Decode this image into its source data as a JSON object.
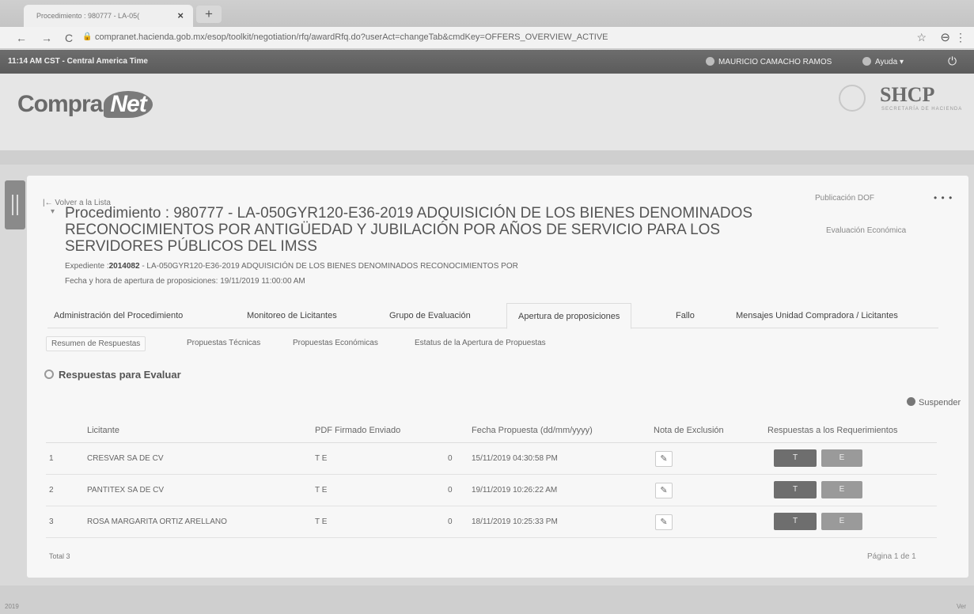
{
  "browser": {
    "tab_title": "Procedimiento : 980777 - LA-05(",
    "tab_close": "×",
    "new_tab": "+",
    "url": "compranet.hacienda.gob.mx/esop/toolkit/negotiation/rfq/awardRfq.do?userAct=changeTab&cmdKey=OFFERS_OVERVIEW_ACTIVE",
    "back_icon": "←",
    "forward_icon": "→",
    "reload_icon": "C",
    "lock_icon": "🔒",
    "star_icon": "☆",
    "profile_icon": "⊖",
    "menu_icon": "⋮"
  },
  "appbar": {
    "clock": "11:14 AM CST - Central America Time",
    "user": "MAURICIO CAMACHO RAMOS",
    "help": "Ayuda",
    "help_caret": "▾",
    "power": "⏻"
  },
  "header": {
    "logo_compra": "Compra",
    "logo_net": "Net",
    "shcp": "SHCP",
    "shcp_sub": "SECRETARÍA DE HACIENDA"
  },
  "actions": {
    "back": "Volver a la Lista",
    "back_icon": "|←",
    "publicacion": "Publicación DOF",
    "more": "• • •",
    "evaluacion": "Evaluación Económica",
    "collapse_icon": "▾"
  },
  "procedure": {
    "title": "Procedimiento : 980777 - LA-050GYR120-E36-2019 ADQUISICIÓN DE LOS BIENES DENOMINADOS RECONOCIMIENTOS POR ANTIGÜEDAD Y JUBILACIÓN POR AÑOS DE SERVICIO PARA LOS SERVIDORES PÚBLICOS DEL IMSS",
    "exp_label": "Expediente :",
    "exp_number": "2014082",
    "exp_rest": " - LA-050GYR120-E36-2019 ADQUISICIÓN DE LOS BIENES DENOMINADOS RECONOCIMIENTOS POR",
    "fecha": "Fecha y hora de apertura de proposiciones: 19/11/2019 11:00:00 AM"
  },
  "tabs": [
    "Administración del Procedimiento",
    "Monitoreo de Licitantes",
    "Grupo de Evaluación",
    "Apertura de proposiciones",
    "Fallo",
    "Mensajes Unidad Compradora / Licitantes"
  ],
  "subtabs": [
    "Resumen de Respuestas",
    "Propuestas Técnicas",
    "Propuestas Económicas",
    "Estatus de la Apertura de Propuestas"
  ],
  "section_title": "Respuestas para Evaluar",
  "suspend": "Suspender",
  "table": {
    "headers": [
      "Licitante",
      "PDF Firmado Enviado",
      "Fecha Propuesta (dd/mm/yyyy)",
      "Nota de Exclusión",
      "Respuestas a los Requerimientos"
    ],
    "rows": [
      {
        "num": "1",
        "name": "CRESVAR SA DE CV",
        "pdf": "T E",
        "count": "0",
        "date": "15/11/2019 04:30:58 PM"
      },
      {
        "num": "2",
        "name": "PANTITEX SA DE CV",
        "pdf": "T E",
        "count": "0",
        "date": "19/11/2019 10:26:22 AM"
      },
      {
        "num": "3",
        "name": "ROSA MARGARITA ORTIZ ARELLANO",
        "pdf": "T E",
        "count": "0",
        "date": "18/11/2019 10:25:33 PM"
      }
    ],
    "btn_t": "T",
    "btn_e": "E",
    "note_icon": "✎"
  },
  "total": "Total 3",
  "pagina": "Página 1 de 1",
  "footer": {
    "left": "2019",
    "right": "Ver"
  }
}
